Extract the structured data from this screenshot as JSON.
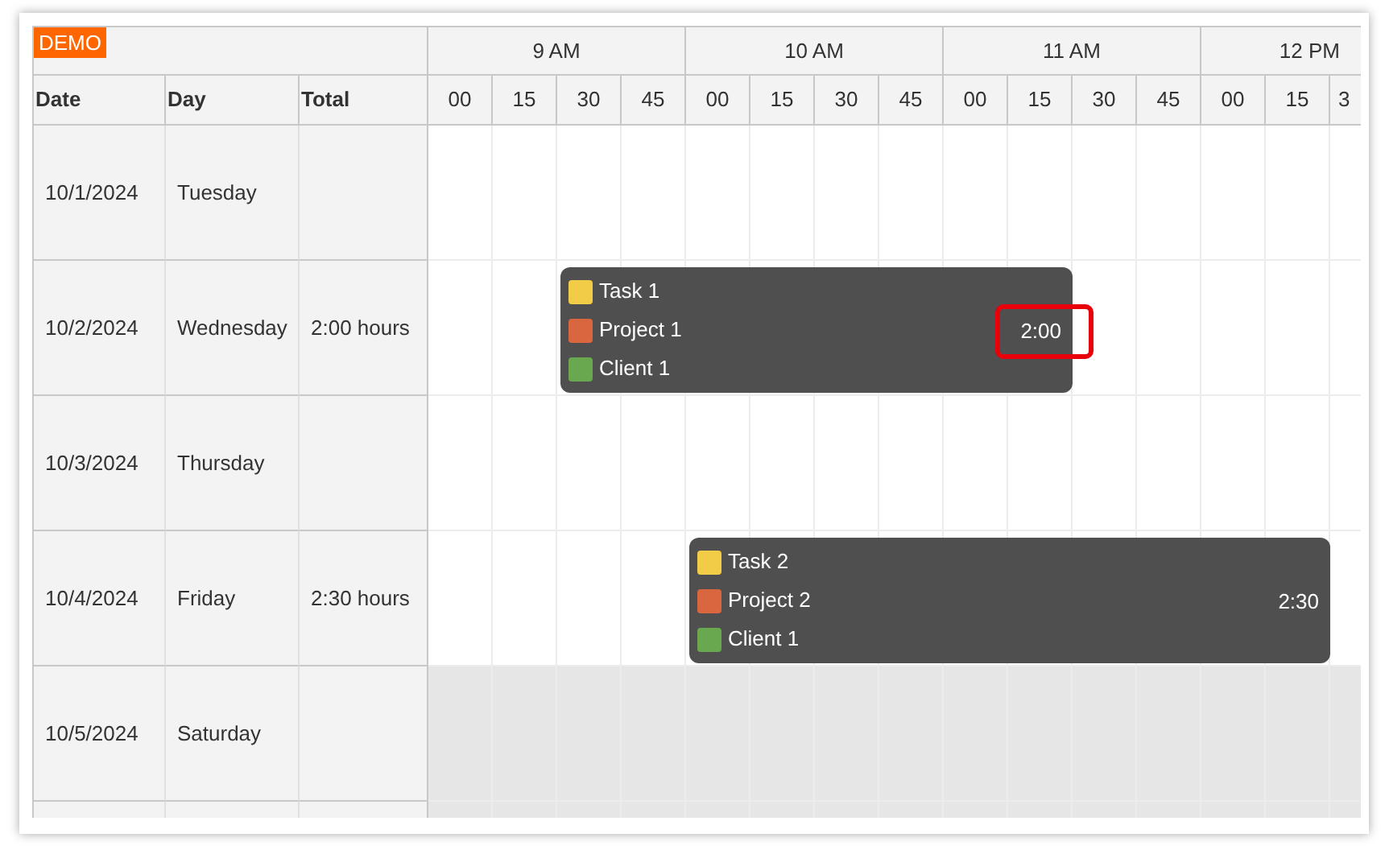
{
  "badge": "DEMO",
  "columns": [
    "Date",
    "Day",
    "Total"
  ],
  "hours": [
    "9 AM",
    "10 AM",
    "11 AM",
    "12 PM"
  ],
  "minutes": [
    "00",
    "15",
    "30",
    "45",
    "00",
    "15",
    "30",
    "45",
    "00",
    "15",
    "30",
    "45",
    "00",
    "15",
    "3"
  ],
  "rows": [
    {
      "date": "10/1/2024",
      "day": "Tuesday",
      "weekend": false,
      "events": []
    },
    {
      "date": "10/2/2024",
      "day": "Wednesday",
      "total": "2:00 hours",
      "weekend": false,
      "events": [
        {
          "duration": "2:00",
          "highlighted": true,
          "lines": [
            {
              "text": "Task 1",
              "color": "#f2cc47"
            },
            {
              "text": "Project 1",
              "color": "#d9663f"
            },
            {
              "text": "Client 1",
              "color": "#6aa84f"
            }
          ]
        }
      ]
    },
    {
      "date": "10/3/2024",
      "day": "Thursday",
      "weekend": false,
      "events": []
    },
    {
      "date": "10/4/2024",
      "day": "Friday",
      "total": "2:30 hours",
      "weekend": false,
      "events": [
        {
          "duration": "2:30",
          "highlighted": false,
          "lines": [
            {
              "text": "Task 2",
              "color": "#f2cc47"
            },
            {
              "text": "Project 2",
              "color": "#d9663f"
            },
            {
              "text": "Client 1",
              "color": "#6aa84f"
            }
          ]
        }
      ]
    },
    {
      "date": "10/5/2024",
      "day": "Saturday",
      "weekend": true,
      "events": []
    },
    {
      "weekend": true,
      "events": []
    }
  ]
}
